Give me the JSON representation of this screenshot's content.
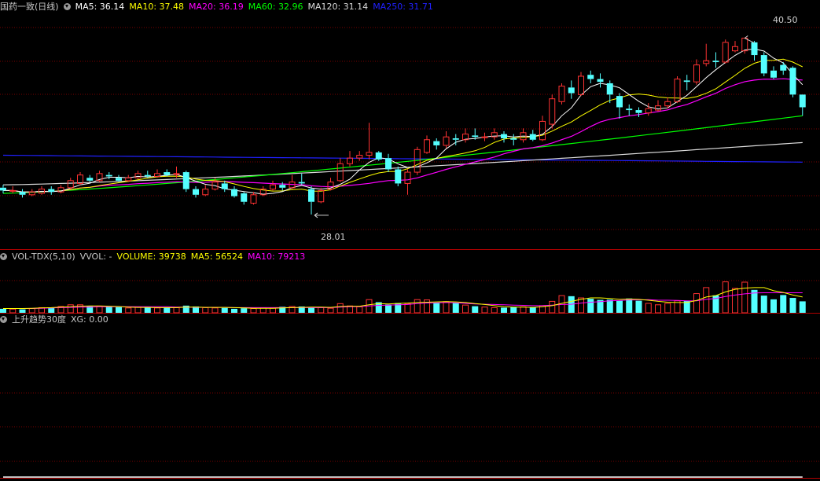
{
  "price_header": {
    "title": "国药一致(日线)",
    "ma5": "MA5: 36.14",
    "ma10": "MA10: 37.48",
    "ma20": "MA20: 36.19",
    "ma60": "MA60: 32.96",
    "ma120": "MA120: 31.14",
    "ma250": "MA250: 31.71"
  },
  "volume_header": {
    "title": "VOL-TDX(5,10)",
    "vvol": "VVOL: -",
    "volume": "VOLUME: 39738",
    "ma5": "MA5: 56524",
    "ma10": "MA10: 79213"
  },
  "indicator_header": {
    "title": "上升趋势30度",
    "xg": "XG: 0.00"
  },
  "annotations": {
    "high": "40.50",
    "low": "28.01"
  },
  "colors": {
    "up": "#ff3232",
    "down": "#54ffff",
    "ma5": "#ffffff",
    "ma10": "#ffff00",
    "ma20": "#ff00ff",
    "ma60": "#00ff00",
    "ma120": "#dcdcdc",
    "ma250": "#2020ff",
    "grid": "#7a0000",
    "divider": "#b00000",
    "signal": "#ffffff"
  },
  "chart_data": {
    "type": "candlestick",
    "title": "国药一致(日线)",
    "price_range": [
      25.6,
      42.2
    ],
    "high_marker": 40.5,
    "low_marker": 28.01,
    "candles": [
      [
        29.9,
        29.7,
        30.1,
        29.5
      ],
      [
        29.7,
        29.7,
        30.0,
        29.5
      ],
      [
        29.6,
        29.4,
        29.8,
        29.2
      ],
      [
        29.4,
        29.6,
        29.8,
        29.3
      ],
      [
        29.5,
        29.8,
        30.0,
        29.4
      ],
      [
        29.8,
        29.6,
        30.0,
        29.4
      ],
      [
        29.6,
        29.9,
        30.1,
        29.5
      ],
      [
        29.9,
        30.4,
        30.6,
        29.8
      ],
      [
        30.2,
        30.8,
        31.0,
        30.1
      ],
      [
        30.6,
        30.4,
        30.8,
        30.3
      ],
      [
        30.4,
        30.9,
        31.1,
        30.3
      ],
      [
        30.8,
        30.7,
        31.0,
        30.5
      ],
      [
        30.6,
        30.4,
        30.8,
        30.3
      ],
      [
        30.4,
        30.6,
        30.8,
        30.3
      ],
      [
        30.6,
        30.9,
        31.1,
        30.5
      ],
      [
        30.8,
        30.7,
        31.1,
        30.6
      ],
      [
        30.7,
        30.9,
        31.2,
        30.6
      ],
      [
        31.0,
        30.8,
        31.2,
        30.7
      ],
      [
        30.9,
        30.9,
        31.4,
        30.6
      ],
      [
        31.0,
        29.8,
        31.1,
        29.6
      ],
      [
        29.8,
        29.4,
        30.0,
        29.2
      ],
      [
        29.4,
        29.8,
        30.1,
        29.3
      ],
      [
        29.8,
        30.3,
        30.6,
        29.7
      ],
      [
        30.2,
        29.8,
        30.4,
        29.6
      ],
      [
        29.8,
        29.3,
        30.0,
        29.2
      ],
      [
        29.5,
        28.9,
        29.6,
        28.7
      ],
      [
        28.8,
        29.4,
        29.6,
        28.7
      ],
      [
        29.4,
        29.8,
        30.0,
        29.3
      ],
      [
        29.8,
        30.1,
        30.4,
        29.7
      ],
      [
        30.1,
        29.9,
        30.3,
        29.7
      ],
      [
        29.9,
        30.3,
        30.8,
        29.8
      ],
      [
        30.3,
        30.2,
        30.9,
        30.1
      ],
      [
        29.8,
        28.9,
        30.0,
        28.0
      ],
      [
        28.9,
        29.7,
        29.9,
        28.8
      ],
      [
        29.8,
        30.3,
        30.6,
        29.7
      ],
      [
        30.4,
        31.6,
        32.0,
        30.3
      ],
      [
        31.6,
        32.0,
        32.5,
        31.4
      ],
      [
        32.0,
        32.2,
        32.5,
        31.8
      ],
      [
        32.2,
        32.4,
        34.5,
        31.9
      ],
      [
        32.4,
        31.9,
        32.5,
        31.8
      ],
      [
        32.0,
        31.2,
        32.3,
        31.0
      ],
      [
        31.2,
        30.2,
        31.4,
        30.0
      ],
      [
        30.2,
        31.0,
        31.2,
        29.4
      ],
      [
        31.0,
        32.6,
        32.8,
        30.8
      ],
      [
        32.4,
        33.3,
        33.6,
        32.3
      ],
      [
        33.2,
        32.9,
        33.4,
        32.6
      ],
      [
        32.9,
        33.5,
        33.9,
        32.7
      ],
      [
        33.4,
        33.3,
        33.7,
        32.9
      ],
      [
        33.3,
        33.7,
        34.1,
        33.1
      ],
      [
        33.6,
        33.5,
        34.1,
        33.3
      ],
      [
        33.5,
        33.5,
        33.8,
        33.2
      ],
      [
        33.5,
        33.8,
        34.1,
        33.3
      ],
      [
        33.7,
        33.4,
        33.9,
        33.1
      ],
      [
        33.4,
        33.3,
        33.7,
        32.9
      ],
      [
        33.3,
        33.8,
        34.1,
        33.1
      ],
      [
        33.7,
        33.3,
        34.0,
        33.2
      ],
      [
        33.3,
        34.6,
        35.0,
        33.2
      ],
      [
        34.4,
        36.2,
        36.5,
        34.1
      ],
      [
        36.0,
        37.1,
        37.3,
        35.8
      ],
      [
        37.0,
        36.6,
        37.5,
        36.2
      ],
      [
        36.5,
        37.8,
        38.1,
        36.4
      ],
      [
        37.9,
        37.6,
        38.2,
        37.3
      ],
      [
        37.6,
        37.4,
        38.0,
        37.0
      ],
      [
        37.3,
        36.5,
        37.5,
        35.9
      ],
      [
        36.4,
        35.6,
        36.6,
        34.8
      ],
      [
        35.5,
        35.4,
        35.8,
        35.0
      ],
      [
        35.4,
        35.2,
        35.6,
        34.9
      ],
      [
        35.2,
        35.5,
        35.9,
        35.0
      ],
      [
        35.4,
        35.7,
        36.1,
        35.3
      ],
      [
        35.7,
        36.0,
        36.3,
        35.5
      ],
      [
        36.0,
        37.6,
        37.8,
        35.9
      ],
      [
        37.5,
        37.4,
        37.9,
        36.8
      ],
      [
        37.4,
        38.6,
        39.0,
        37.2
      ],
      [
        38.7,
        38.9,
        40.1,
        38.5
      ],
      [
        38.9,
        38.8,
        39.5,
        38.4
      ],
      [
        38.8,
        40.2,
        40.4,
        38.7
      ],
      [
        39.6,
        39.9,
        40.3,
        39.5
      ],
      [
        39.6,
        40.5,
        40.5,
        39.4
      ],
      [
        40.2,
        39.3,
        40.3,
        38.9
      ],
      [
        39.3,
        38.0,
        39.5,
        37.8
      ],
      [
        38.2,
        37.7,
        38.5,
        37.6
      ],
      [
        38.6,
        38.2,
        38.8,
        37.9
      ],
      [
        38.4,
        36.5,
        38.5,
        36.3
      ],
      [
        36.5,
        35.6,
        36.5,
        35.0
      ]
    ],
    "volume_range": [
      0,
      170000
    ],
    "volumes": [
      14000,
      13000,
      12000,
      15000,
      18000,
      17000,
      22000,
      28000,
      28000,
      24000,
      22000,
      21000,
      20000,
      17000,
      19000,
      18000,
      17000,
      18000,
      18000,
      25000,
      22000,
      18000,
      17000,
      17000,
      14000,
      16000,
      15000,
      17000,
      16000,
      21000,
      22000,
      22000,
      20000,
      18000,
      16000,
      32000,
      24000,
      21000,
      46000,
      37000,
      29000,
      34000,
      32000,
      46000,
      45000,
      34000,
      39000,
      34000,
      27000,
      23000,
      20000,
      18000,
      18000,
      20000,
      21000,
      20000,
      25000,
      40000,
      60000,
      58000,
      52000,
      49000,
      45000,
      46000,
      42000,
      50000,
      42000,
      33000,
      28000,
      33000,
      42000,
      42000,
      67000,
      88000,
      61000,
      108000,
      85000,
      107000,
      80000,
      60000,
      47000,
      62000,
      52000,
      40000
    ],
    "volume_ma5": [
      15000,
      15000,
      15000,
      16000,
      17000,
      18000,
      20000,
      21000,
      23000,
      24000,
      24000,
      23000,
      22000,
      20000,
      19000,
      19000,
      18000,
      18000,
      18000,
      20000,
      20000,
      19000,
      19000,
      19000,
      18000,
      17000,
      16000,
      16000,
      16000,
      17000,
      18000,
      19000,
      20000,
      20000,
      19000,
      22000,
      23000,
      23000,
      28000,
      32000,
      31000,
      33000,
      34000,
      36000,
      37000,
      38000,
      39000,
      38000,
      36000,
      32000,
      29000,
      25000,
      21000,
      20000,
      20000,
      19000,
      21000,
      25000,
      33000,
      40000,
      47000,
      52000,
      52000,
      50000,
      47000,
      48000,
      47000,
      44000,
      40000,
      37000,
      36000,
      36000,
      43000,
      55000,
      60000,
      73000,
      82000,
      86000,
      88000,
      88000,
      77000,
      71000,
      62000,
      55000
    ],
    "volume_ma10": [
      15000,
      15000,
      15000,
      15000,
      16000,
      17000,
      18000,
      19000,
      20000,
      20000,
      21000,
      21000,
      21000,
      21000,
      21000,
      21000,
      21000,
      21000,
      20000,
      20000,
      19000,
      19000,
      19000,
      19000,
      18000,
      18000,
      18000,
      18000,
      18000,
      18000,
      18000,
      18000,
      18000,
      18000,
      18000,
      20000,
      21000,
      22000,
      24000,
      26000,
      27000,
      28000,
      29000,
      32000,
      34000,
      35000,
      36000,
      35000,
      33000,
      31000,
      30000,
      29000,
      28000,
      27000,
      26000,
      25000,
      25000,
      27000,
      29000,
      30000,
      34000,
      37000,
      39000,
      42000,
      43000,
      45000,
      45000,
      46000,
      44000,
      44000,
      43000,
      42000,
      42000,
      47000,
      50000,
      57000,
      62000,
      66000,
      69000,
      70000,
      70000,
      70000,
      70000,
      70000
    ],
    "indicator_range": [
      0,
      1
    ],
    "xg_signals": [
      0,
      0,
      0,
      0,
      0,
      0,
      0,
      0,
      0,
      0,
      0,
      0,
      0,
      0,
      0,
      0,
      0,
      0,
      0,
      0,
      0,
      0,
      0,
      0,
      0,
      0,
      0,
      0,
      0,
      0,
      0,
      0,
      0,
      0,
      0,
      0,
      0,
      0,
      0,
      0,
      0,
      0,
      0,
      0,
      0,
      0,
      0,
      0,
      0,
      0,
      0,
      0,
      0,
      0,
      0,
      0,
      0,
      0,
      0,
      0,
      0,
      0,
      0,
      0,
      0,
      0,
      0,
      0,
      0,
      0,
      0,
      0,
      0,
      0,
      0,
      0,
      0,
      0,
      0,
      0,
      0,
      0,
      0,
      0
    ]
  }
}
